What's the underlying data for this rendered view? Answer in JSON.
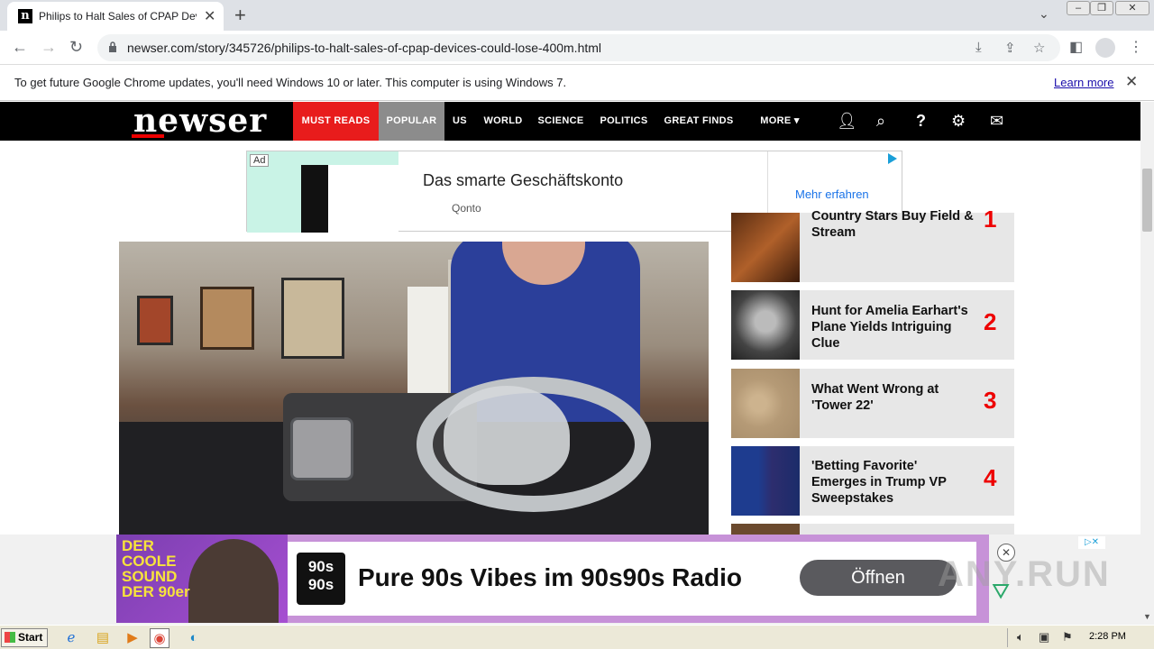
{
  "browser": {
    "tab_title": "Philips to Halt Sales of CPAP Devices",
    "tab_favicon": "n",
    "url": "newser.com/story/345726/philips-to-halt-sales-of-cpap-devices-could-lose-400m.html",
    "infobar_text": "To get future Google Chrome updates, you'll need Windows 10 or later. This computer is using Windows 7.",
    "infobar_link": "Learn more"
  },
  "site": {
    "logo": "newser",
    "nav": [
      "MUST READS",
      "POPULAR",
      "US",
      "WORLD",
      "SCIENCE",
      "POLITICS",
      "GREAT FINDS",
      "MORE ▾"
    ]
  },
  "ad_top": {
    "badge": "Ad",
    "title": "Das smarte Geschäftskonto",
    "advertiser": "Qonto",
    "cta": "Mehr erfahren"
  },
  "sidebar": {
    "items": [
      {
        "title": "Country Stars Buy Field & Stream",
        "rank": "1"
      },
      {
        "title": "Hunt for Amelia Earhart's Plane Yields Intriguing Clue",
        "rank": "2"
      },
      {
        "title": "What Went Wrong at 'Tower 22'",
        "rank": "3"
      },
      {
        "title": "'Betting Favorite' Emerges in Trump VP Sweepstakes",
        "rank": "4"
      }
    ]
  },
  "ad_bottom": {
    "left_text": "DER COOLE SOUND DER 90er",
    "logo_text": "90s 90s",
    "title": "Pure 90s Vibes im 90s90s Radio",
    "cta": "Öffnen",
    "watermark": "ANY.RUN"
  },
  "taskbar": {
    "start": "Start",
    "clock": "2:28 PM"
  },
  "colors": {
    "nav_red": "#e81c1c",
    "rank_red": "#ee0000",
    "nav_bg": "#000000"
  }
}
